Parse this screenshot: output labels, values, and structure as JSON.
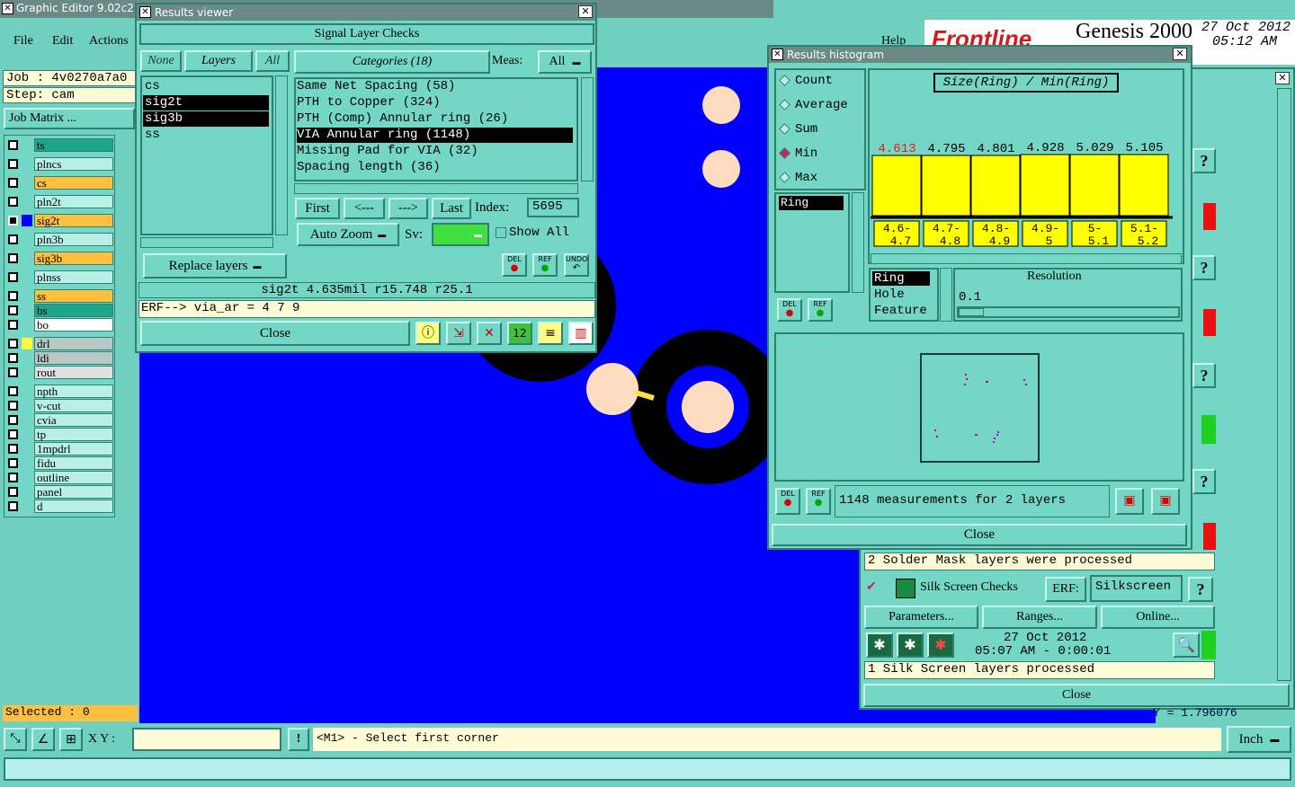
{
  "app": {
    "title": "Graphic Editor 9.02c2 (",
    "menu": [
      "File",
      "Edit",
      "Actions"
    ],
    "help": "Help",
    "brand": "Frontline",
    "product": "Genesis 2000",
    "date": "27 Oct 2012",
    "time": "05:12 AM",
    "job": "Job : 4v0270a7a0",
    "step": "Step: cam",
    "job_matrix": "Job Matrix ...",
    "selected": "Selected : 0",
    "xy_label": "X Y :",
    "status_msg": "<M1> - Select first corner",
    "units": "Inch",
    "coord_peek": "Y = 1.796076"
  },
  "layers": [
    {
      "name": "ts",
      "color": "#1fa58a"
    },
    {
      "name": "plncs",
      "color": "#b8f0e6"
    },
    {
      "name": "cs",
      "color": "#ffc040"
    },
    {
      "name": "pln2t",
      "color": "#b8f0e6"
    },
    {
      "name": "sig2t",
      "color": "#ffc040"
    },
    {
      "name": "pln3b",
      "color": "#b8f0e6"
    },
    {
      "name": "sig3b",
      "color": "#ffc040"
    },
    {
      "name": "plnss",
      "color": "#b8f0e6"
    },
    {
      "name": "ss",
      "color": "#ffc040"
    },
    {
      "name": "bs",
      "color": "#1fa58a"
    },
    {
      "name": "bo",
      "color": "#ffffff"
    },
    {
      "name": "drl",
      "color": "#b8c8c4"
    },
    {
      "name": "ldi",
      "color": "#b8c8c4"
    },
    {
      "name": "rout",
      "color": "#e0e0e0"
    },
    {
      "name": "npth",
      "color": "#b8f0e6"
    },
    {
      "name": "v-cut",
      "color": "#b8f0e6"
    },
    {
      "name": "cvia",
      "color": "#b8f0e6"
    },
    {
      "name": "tp",
      "color": "#b8f0e6"
    },
    {
      "name": "1mpdrl",
      "color": "#b8f0e6"
    },
    {
      "name": "fidu",
      "color": "#b8f0e6"
    },
    {
      "name": "outline",
      "color": "#b8f0e6"
    },
    {
      "name": "panel",
      "color": "#b8f0e6"
    },
    {
      "name": "d",
      "color": "#b8f0e6"
    }
  ],
  "results_viewer": {
    "title": "Results viewer",
    "header": "Signal Layer Checks",
    "none": "None",
    "layers_tab": "Layers",
    "all": "All",
    "categories_tab": "Categories (18)",
    "meas_label": "Meas:",
    "meas_value": "All",
    "layer_list": [
      "cs",
      "sig2t",
      "sig3b",
      "ss"
    ],
    "category_list": [
      "Same Net Spacing (58)",
      "PTH to Copper (324)",
      "PTH (Comp) Annular ring (26)",
      "VIA Annular ring (1148)",
      "Missing Pad for VIA (32)",
      "Spacing length (36)"
    ],
    "first": "First",
    "prev": "<---",
    "next": "--->",
    "last": "Last",
    "index_label": "Index:",
    "index_value": "5695",
    "auto_zoom": "Auto Zoom",
    "sv_label": "Sv:",
    "show_all": "Show All",
    "replace_layers": "Replace layers",
    "del": "DEL",
    "ref": "REF",
    "undo": "UNDO",
    "info": "sig2t 4.635mil r15.748 r25.1",
    "erf": "ERF--> via_ar = 4 7 9",
    "close": "Close"
  },
  "histogram": {
    "title": "Results histogram",
    "options": [
      "Count",
      "Average",
      "Sum",
      "Min",
      "Max"
    ],
    "selected_option": "Min",
    "heading": "Size(Ring) / Min(Ring)",
    "list": [
      "Ring"
    ],
    "type_list": [
      "Ring",
      "Hole",
      "Feature"
    ],
    "resolution_label": "Resolution",
    "resolution_value": "0.1",
    "summary": "1148 measurements for 2 layers",
    "close": "Close",
    "del": "DEL",
    "ref": "REF"
  },
  "chart_data": {
    "type": "bar",
    "categories": [
      "4.6-4.7",
      "4.7-4.8",
      "4.8-4.9",
      "4.9-5",
      "5-5.1",
      "5.1-5.2"
    ],
    "values": [
      4.613,
      4.795,
      4.801,
      4.928,
      5.029,
      5.105
    ],
    "value_labels": [
      "4.613",
      "4.795",
      "4.801",
      "4.928",
      "5.029",
      "5.105"
    ],
    "category_labels_top": [
      "4.6-",
      "4.7-",
      "4.8-",
      "4.9-",
      "5-",
      "5.1-"
    ],
    "category_labels_bottom": [
      "4.7",
      "4.8",
      "4.9",
      "5",
      "5.1",
      "5.2"
    ],
    "highlight_index": 0,
    "bar_color": "#ffff00",
    "highlight_label_color": "#e02020"
  },
  "checklist": {
    "solder_msg": "2 Solder Mask layers were processed",
    "silk_title": "Silk Screen Checks",
    "erf_label": "ERF:",
    "erf_value": "Silkscreen",
    "parameters": "Parameters...",
    "ranges": "Ranges...",
    "online": "Online...",
    "date": "27 Oct 2012",
    "time": "05:07 AM - 0:00:01",
    "silk_msg": "1 Silk Screen layers processed",
    "close": "Close",
    "help": "?"
  }
}
